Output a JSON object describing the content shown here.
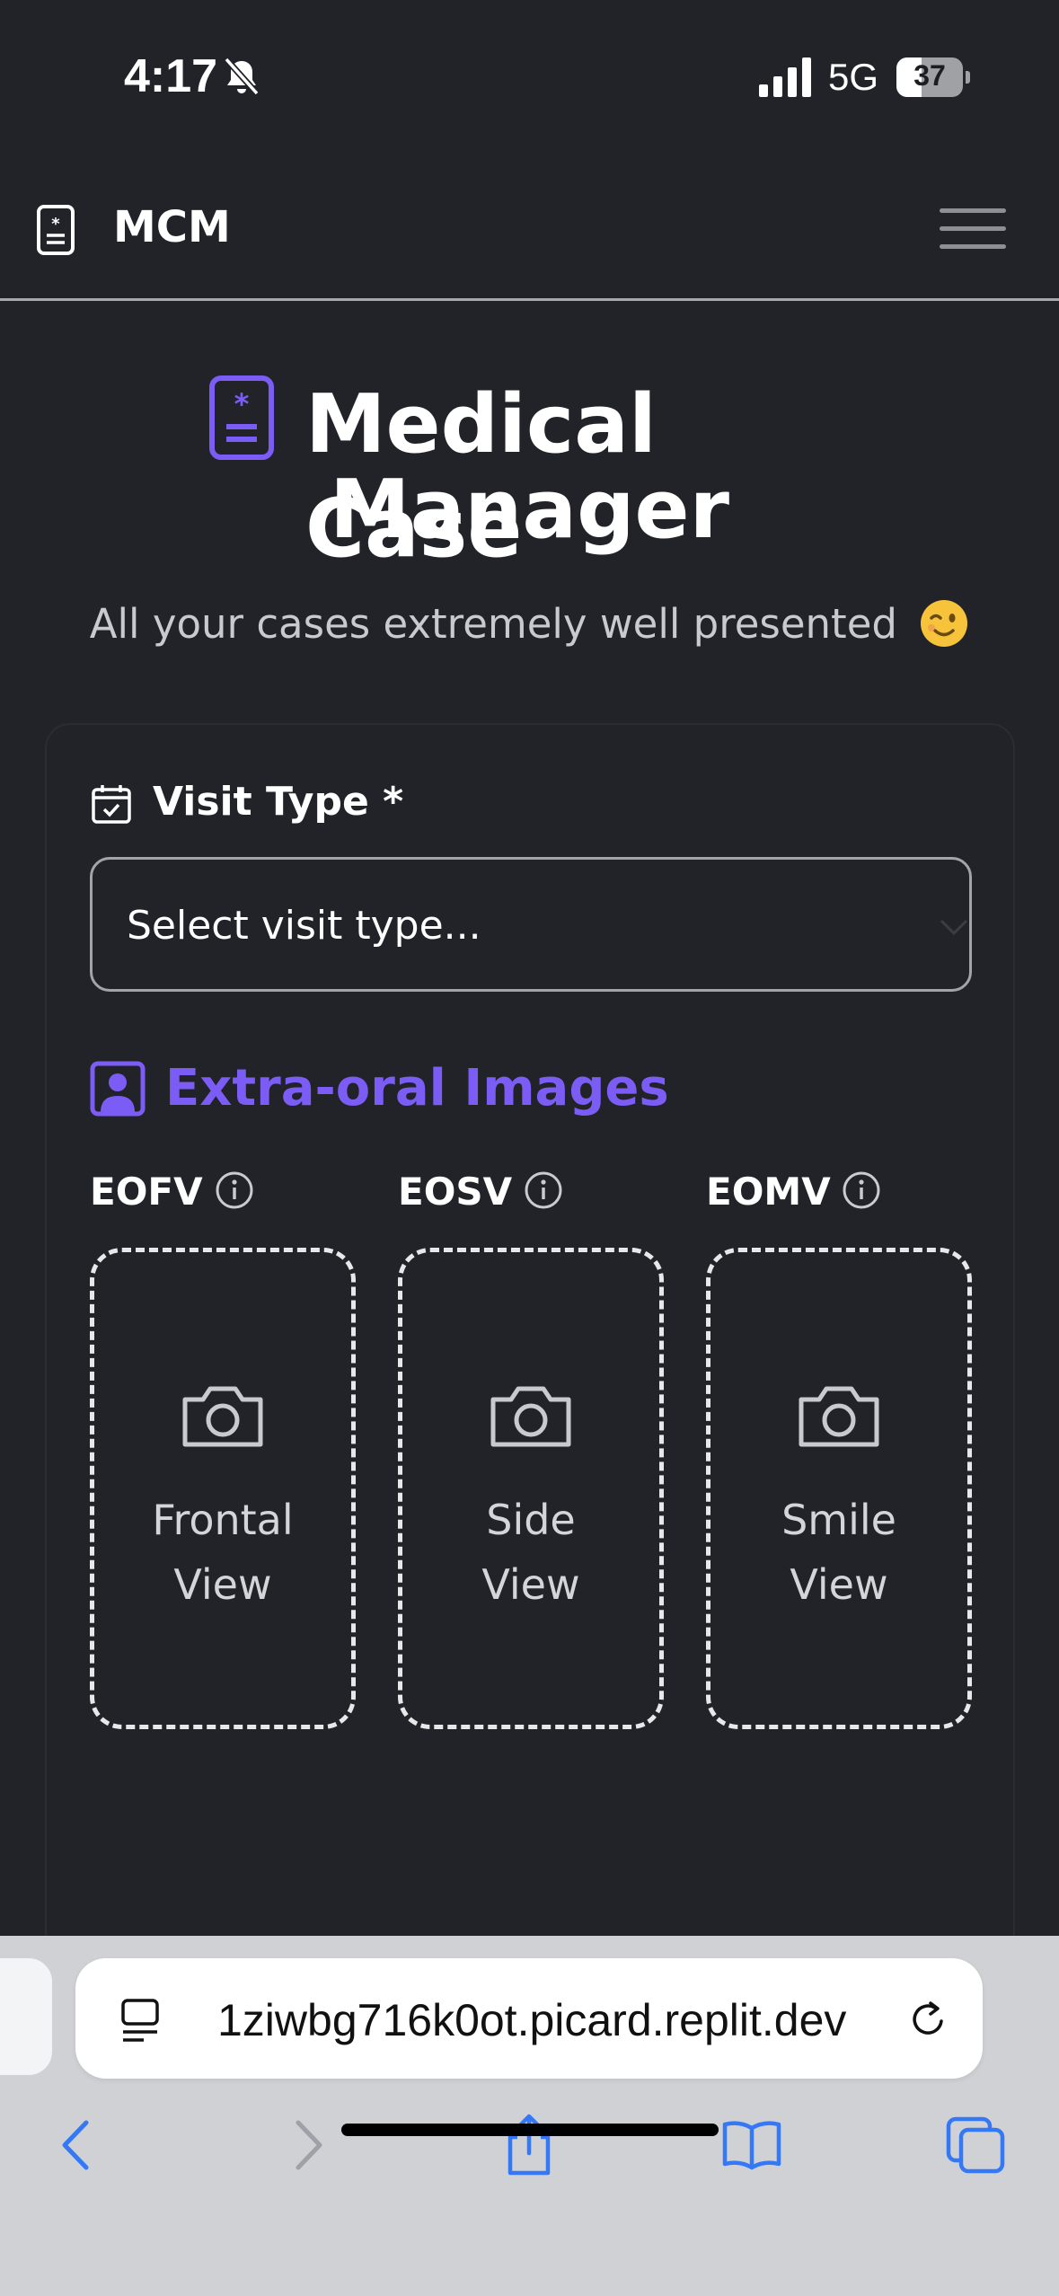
{
  "status_bar": {
    "time": "4:17",
    "network": "5G",
    "battery": "37",
    "silent_icon": "bell-slash-icon",
    "signal_icon": "cellular-signal-icon"
  },
  "navbar": {
    "brand": "MCM",
    "brand_icon": "medical-badge-icon",
    "menu_icon": "hamburger-icon"
  },
  "header": {
    "title_line1": "Medical Case",
    "title_line2": "Manager",
    "subtitle": "All your cases extremely well presented",
    "subtitle_emoji": "winking-face-emoji",
    "accent_color": "#7b5cf5"
  },
  "form": {
    "visit_type_label": "Visit Type *",
    "visit_type_placeholder": "Select visit type...",
    "section_title": "Extra-oral Images",
    "images": [
      {
        "code": "EOFV",
        "line1": "Frontal",
        "line2": "View"
      },
      {
        "code": "EOSV",
        "line1": "Side",
        "line2": "View"
      },
      {
        "code": "EOMV",
        "line1": "Smile",
        "line2": "View"
      }
    ]
  },
  "browser": {
    "url": "1ziwbg716k0ot.picard.replit.dev",
    "toolbar_icons": [
      "back-icon",
      "forward-icon",
      "share-icon",
      "bookmarks-icon",
      "tabs-icon"
    ]
  }
}
